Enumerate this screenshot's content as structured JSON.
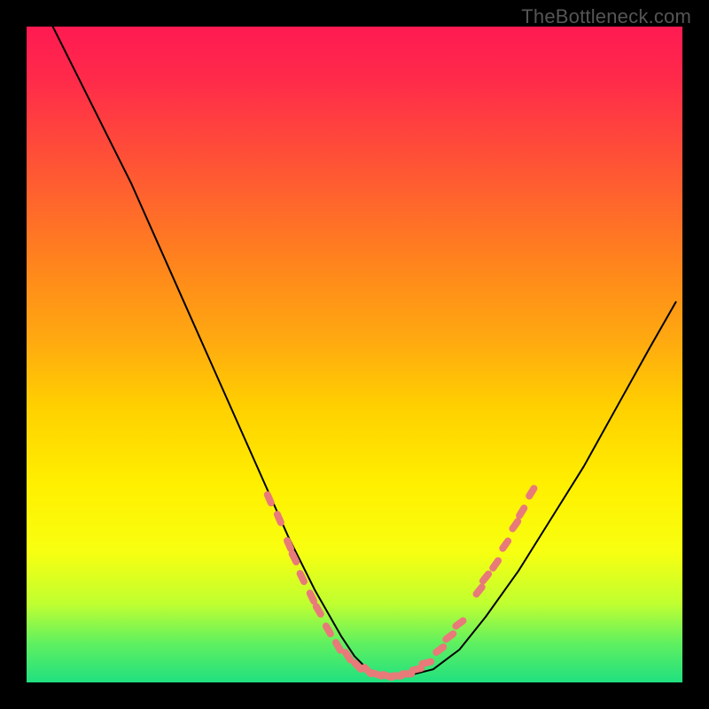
{
  "watermark": "TheBottleneck.com",
  "chart_data": {
    "type": "line",
    "title": "",
    "xlabel": "",
    "ylabel": "",
    "xlim": [
      0,
      100
    ],
    "ylim": [
      0,
      100
    ],
    "series": [
      {
        "name": "curve",
        "x": [
          4,
          8,
          12,
          16,
          20,
          24,
          28,
          32,
          36,
          40,
          44,
          48,
          50,
          52,
          55,
          58,
          62,
          66,
          70,
          75,
          80,
          85,
          90,
          95,
          99
        ],
        "y": [
          100,
          92,
          84,
          76,
          67,
          58,
          49,
          40,
          31,
          22,
          14,
          7,
          4,
          2,
          1,
          1,
          2,
          5,
          10,
          17,
          25,
          33,
          42,
          51,
          58
        ]
      }
    ],
    "markers": [
      {
        "x": 37,
        "y": 28
      },
      {
        "x": 38.5,
        "y": 25
      },
      {
        "x": 40,
        "y": 21
      },
      {
        "x": 40.8,
        "y": 19
      },
      {
        "x": 42,
        "y": 16
      },
      {
        "x": 43.5,
        "y": 13
      },
      {
        "x": 44.5,
        "y": 11
      },
      {
        "x": 46,
        "y": 8
      },
      {
        "x": 47.5,
        "y": 5.5
      },
      {
        "x": 49,
        "y": 4
      },
      {
        "x": 50.5,
        "y": 2.5
      },
      {
        "x": 52,
        "y": 1.8
      },
      {
        "x": 53.5,
        "y": 1.2
      },
      {
        "x": 55,
        "y": 1
      },
      {
        "x": 56.5,
        "y": 1
      },
      {
        "x": 58,
        "y": 1.3
      },
      {
        "x": 59.5,
        "y": 2
      },
      {
        "x": 61,
        "y": 3
      },
      {
        "x": 63,
        "y": 5
      },
      {
        "x": 64.5,
        "y": 7
      },
      {
        "x": 66,
        "y": 9
      },
      {
        "x": 69,
        "y": 14
      },
      {
        "x": 70,
        "y": 16
      },
      {
        "x": 71.5,
        "y": 18
      },
      {
        "x": 73,
        "y": 21
      },
      {
        "x": 74.5,
        "y": 24
      },
      {
        "x": 75.5,
        "y": 26
      },
      {
        "x": 77,
        "y": 29
      }
    ],
    "marker_color": "#e87a7a"
  }
}
